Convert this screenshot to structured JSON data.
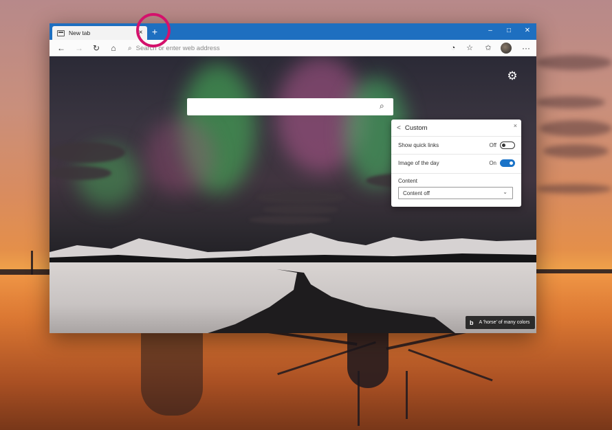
{
  "browser": {
    "tab_title": "New tab",
    "tab_close": "×",
    "new_tab": "+",
    "window_controls": {
      "minimize": "–",
      "maximize": "□",
      "close": "✕"
    },
    "toolbar": {
      "back": "←",
      "forward": "→",
      "refresh": "↻",
      "home": "⌂",
      "address_placeholder": "Search or enter web address",
      "more": "···"
    }
  },
  "page": {
    "search_icon": "⌕",
    "settings_icon": "⚙"
  },
  "panel": {
    "back": "<",
    "title": "Custom",
    "close": "×",
    "rows": [
      {
        "label": "Show quick links",
        "state": "Off",
        "on": false
      },
      {
        "label": "Image of the day",
        "state": "On",
        "on": true
      }
    ],
    "content_label": "Content",
    "content_selected": "Content off",
    "chevron": "⌄"
  },
  "image_credit": {
    "logo": "b",
    "text": "A 'horse' of many colors"
  },
  "colors": {
    "titlebar": "#1e6fc0",
    "toggle_on": "#1a73c8",
    "highlight": "#d4116c"
  }
}
